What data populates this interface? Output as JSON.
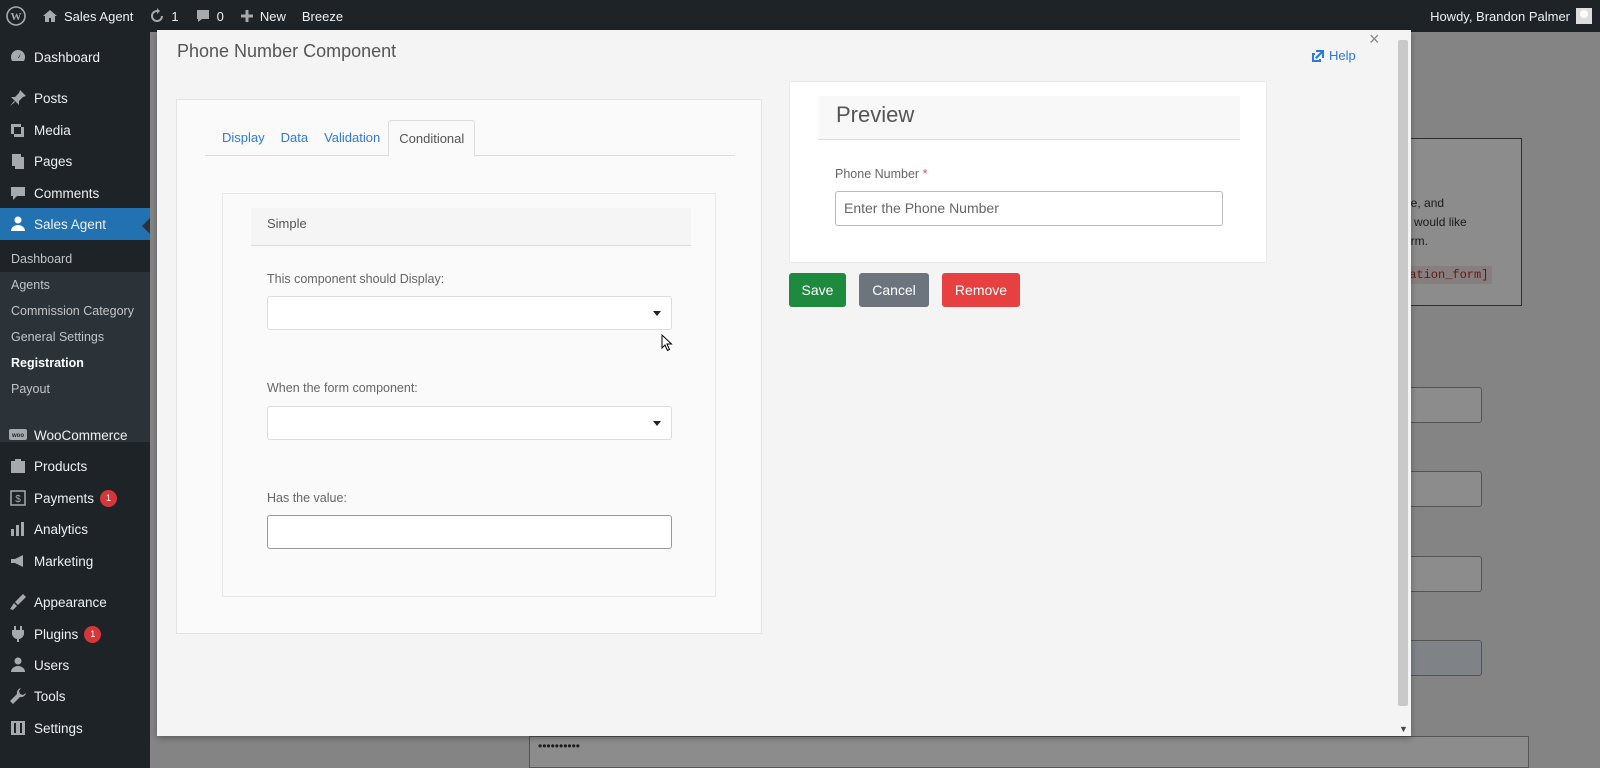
{
  "adminbar": {
    "site_name": "Sales Agent",
    "updates_count": "1",
    "comments_count": "0",
    "new_label": "New",
    "breeze_label": "Breeze",
    "howdy": "Howdy, Brandon Palmer"
  },
  "sidebar": {
    "items": [
      {
        "label": "Dashboard",
        "icon": "dashboard-icon"
      },
      {
        "label": "Posts",
        "icon": "pin-icon"
      },
      {
        "label": "Media",
        "icon": "media-icon"
      },
      {
        "label": "Pages",
        "icon": "pages-icon"
      },
      {
        "label": "Comments",
        "icon": "comment-icon"
      },
      {
        "label": "Sales Agent",
        "icon": "user-icon"
      },
      {
        "label": "WooCommerce",
        "icon": "woo-icon"
      },
      {
        "label": "Products",
        "icon": "products-icon"
      },
      {
        "label": "Payments",
        "icon": "payments-icon",
        "badge": "1"
      },
      {
        "label": "Analytics",
        "icon": "analytics-icon"
      },
      {
        "label": "Marketing",
        "icon": "megaphone-icon"
      },
      {
        "label": "Appearance",
        "icon": "brush-icon"
      },
      {
        "label": "Plugins",
        "icon": "plugin-icon",
        "badge": "1"
      },
      {
        "label": "Users",
        "icon": "users-icon"
      },
      {
        "label": "Tools",
        "icon": "wrench-icon"
      },
      {
        "label": "Settings",
        "icon": "settings-icon"
      }
    ],
    "submenu": [
      "Dashboard",
      "Agents",
      "Commission Category",
      "General Settings",
      "Registration",
      "Payout"
    ]
  },
  "background": {
    "notice_lines": [
      "de, and",
      "u would like",
      "orm."
    ],
    "shortcode": "ration_form]",
    "password_mask": "••••••••••"
  },
  "modal": {
    "title": "Phone Number Component",
    "help_label": "Help",
    "close_symbol": "×",
    "tabs": [
      "Display",
      "Data",
      "Validation",
      "Conditional"
    ],
    "conditional": {
      "heading": "Simple",
      "display_label": "This component should Display:",
      "when_label": "When the form component:",
      "value_label": "Has the value:"
    },
    "preview": {
      "heading": "Preview",
      "field_label": "Phone Number",
      "required_mark": "*",
      "placeholder": "Enter the Phone Number"
    },
    "buttons": {
      "save": "Save",
      "cancel": "Cancel",
      "remove": "Remove"
    }
  },
  "colors": {
    "adminbar_bg": "#1d2327",
    "active_menu": "#2271b1",
    "save_button": "#1e8a3e",
    "cancel_button": "#6c757d",
    "remove_button": "#e74040",
    "link": "#2a7ae4"
  }
}
